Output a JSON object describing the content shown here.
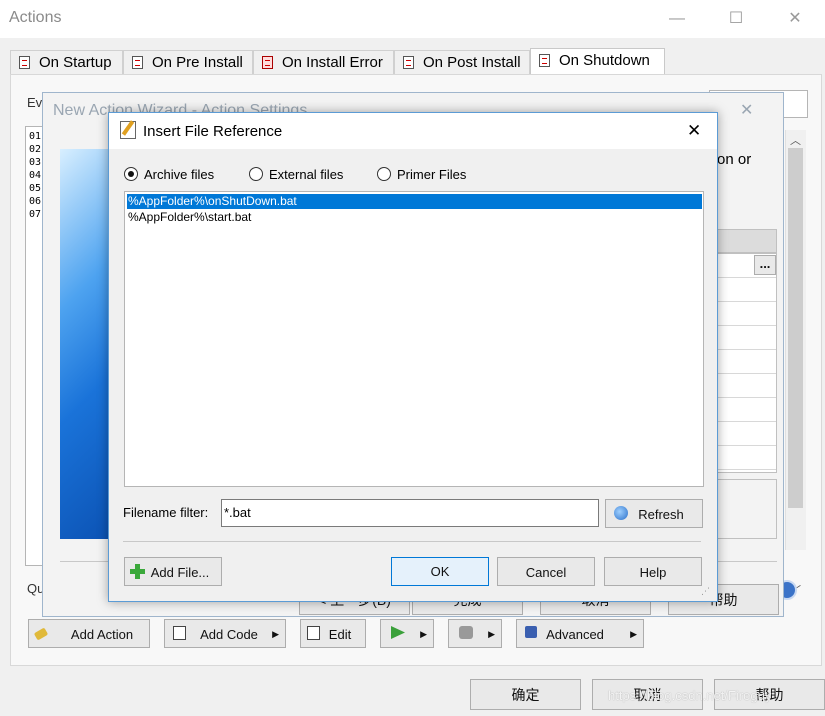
{
  "window": {
    "title": "Actions",
    "minimize": "—",
    "maximize": "☐",
    "close": "✕"
  },
  "tabs": [
    {
      "label": "On Startup",
      "active": false
    },
    {
      "label": "On Pre Install",
      "active": false
    },
    {
      "label": "On Install Error",
      "active": false
    },
    {
      "label": "On Post Install",
      "active": false
    },
    {
      "label": "On Shutdown",
      "active": true
    }
  ],
  "panel": {
    "events_label": "Ev",
    "line_numbers": [
      "01",
      "02",
      "03",
      "04",
      "05",
      "06",
      "07"
    ],
    "quick_label": "Qu",
    "buttons": {
      "add_action": "Add Action",
      "add_code": "Add Code",
      "edit": "Edit",
      "advanced": "Advanced"
    }
  },
  "wizard": {
    "title": "New Action Wizard - Action Settings",
    "partial_text": "on or",
    "cell_button": "...",
    "back_button": "< 上一步(B)",
    "finish_button": "完成",
    "cancel_button": "取消",
    "help_button": "帮助"
  },
  "dialog": {
    "title": "Insert File Reference",
    "close": "✕",
    "radios": [
      {
        "label": "Archive files",
        "checked": true
      },
      {
        "label": "External files",
        "checked": false
      },
      {
        "label": "Primer Files",
        "checked": false
      }
    ],
    "files": [
      {
        "name": "%AppFolder%\\onShutDown.bat",
        "selected": true
      },
      {
        "name": "%AppFolder%\\start.bat",
        "selected": false
      }
    ],
    "filter_label": "Filename filter:",
    "filter_value": "*.bat",
    "refresh_button": "Refresh",
    "add_file_button": "Add File...",
    "ok_button": "OK",
    "cancel_button": "Cancel",
    "help_button": "Help"
  },
  "footer": {
    "ok_button": "确定",
    "cancel_button": "取消",
    "help_button": "帮助",
    "watermark": "https://blog.csdn.net/Fireguy"
  }
}
